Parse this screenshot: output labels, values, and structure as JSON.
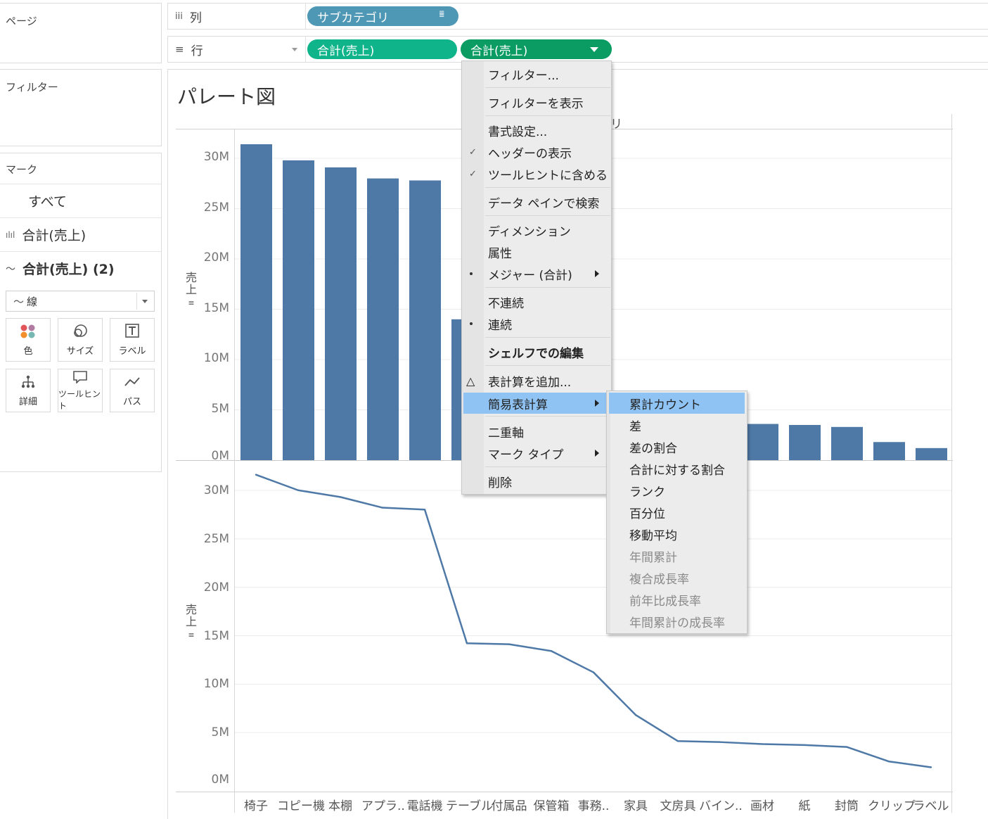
{
  "panels": {
    "pages_title": "ページ",
    "filters_title": "フィルター",
    "marks_title": "マーク",
    "marks_all": "すべて",
    "marks_card1": "合計(売上)",
    "marks_card2": "合計(売上) (2)",
    "mark_type": "線",
    "mark_buttons": [
      "色",
      "サイズ",
      "ラベル",
      "詳細",
      "ツールヒント",
      "パス"
    ]
  },
  "shelves": {
    "columns_label": "列",
    "rows_label": "行",
    "columns_pill": "サブカテゴリ",
    "rows_pill1": "合計(売上)",
    "rows_pill2": "合計(売上)"
  },
  "colors": {
    "bar": "#4e79a7",
    "pill_dimension": "#4e97b5",
    "pill_measure": "#0fb48a",
    "pill_measure_active": "#0a9c63",
    "menu_highlight": "#8fc3f3"
  },
  "sheet": {
    "title": "パレート図",
    "header_partial": "リ",
    "y_label": "売上"
  },
  "chart_data": [
    {
      "type": "bar",
      "categories": [
        "椅子",
        "コピー機",
        "本棚",
        "アプラ..",
        "電話機",
        "テーブル",
        "付属品",
        "保管箱",
        "事務..",
        "家具",
        "文房具",
        "バイン..",
        "画材",
        "紙",
        "封筒",
        "クリップ",
        "ラベル"
      ],
      "values": [
        31.4,
        29.8,
        29.1,
        28.0,
        27.8,
        14.0,
        13.9,
        13.2,
        11.0,
        6.6,
        3.9,
        3.8,
        3.6,
        3.5,
        3.3,
        1.8,
        1.2
      ],
      "ylim": [
        0,
        33
      ],
      "yticks": [
        "0M",
        "5M",
        "10M",
        "15M",
        "20M",
        "25M",
        "30M"
      ],
      "ylabel": "売上"
    },
    {
      "type": "line",
      "categories": [
        "椅子",
        "コピー機",
        "本棚",
        "アプラ..",
        "電話機",
        "テーブル",
        "付属品",
        "保管箱",
        "事務..",
        "家具",
        "文房具",
        "バイン..",
        "画材",
        "紙",
        "封筒",
        "クリップ",
        "ラベル"
      ],
      "values": [
        31.4,
        29.8,
        29.1,
        28.0,
        27.8,
        14.0,
        13.9,
        13.2,
        11.0,
        6.6,
        3.9,
        3.8,
        3.6,
        3.5,
        3.3,
        1.8,
        1.2
      ],
      "ylim": [
        0,
        33
      ],
      "yticks": [
        "0M",
        "5M",
        "10M",
        "15M",
        "20M",
        "25M",
        "30M"
      ],
      "ylabel": "売上"
    }
  ],
  "context_menu": {
    "items": [
      "フィルター...",
      "フィルターを表示",
      "書式設定...",
      "ヘッダーの表示",
      "ツールヒントに含める",
      "データ ペインで検索",
      "ディメンション",
      "属性",
      "メジャー (合計)",
      "不連続",
      "連続",
      "シェルフでの編集",
      "表計算を追加...",
      "簡易表計算",
      "二重軸",
      "マーク タイプ",
      "削除"
    ]
  },
  "submenu": {
    "items": [
      "累計カウント",
      "差",
      "差の割合",
      "合計に対する割合",
      "ランク",
      "百分位",
      "移動平均",
      "年間累計",
      "複合成長率",
      "前年比成長率",
      "年間累計の成長率"
    ]
  }
}
